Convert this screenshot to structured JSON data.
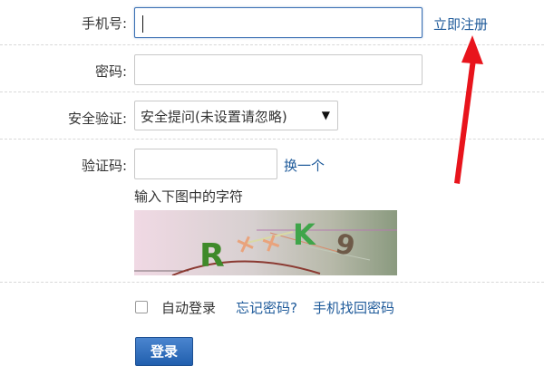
{
  "form": {
    "phone": {
      "label": "手机号:",
      "value": "",
      "placeholder": ""
    },
    "register_link": "立即注册",
    "password": {
      "label": "密码:",
      "value": ""
    },
    "security": {
      "label": "安全验证:",
      "selected": "安全提问(未设置请忽略)",
      "arrow": "▼"
    },
    "captcha": {
      "label": "验证码:",
      "value": "",
      "refresh_link": "换一个",
      "hint": "输入下图中的字符",
      "image_text": "R K 9"
    },
    "auto_login_label": "自动登录",
    "forgot_link": "忘记密码?",
    "phone_recover_link": "手机找回密码",
    "login_button": "登录"
  },
  "colors": {
    "accent": "#3a6fb3",
    "link": "#1e5a9a",
    "annotation_arrow": "#e8141c"
  },
  "icons": [
    "red-annotation-arrow-icon",
    "chevron-down-icon",
    "checkbox-icon"
  ]
}
